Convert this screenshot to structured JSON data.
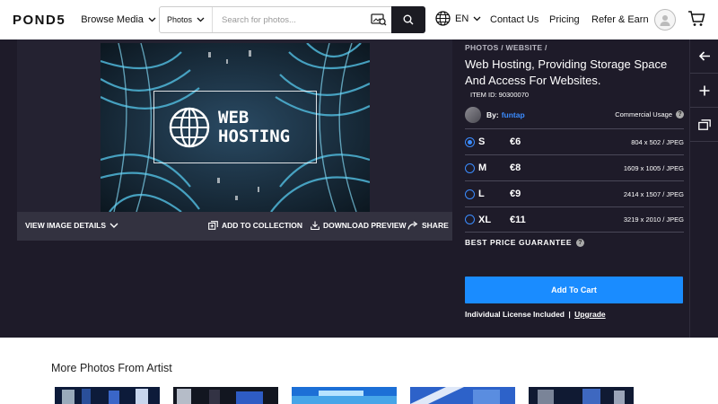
{
  "header": {
    "logo": "POND5",
    "browse_label": "Browse Media",
    "search_type": "Photos",
    "search_placeholder": "Search for photos...",
    "language": "EN",
    "nav": [
      "Contact Us",
      "Pricing",
      "Refer & Earn"
    ]
  },
  "image": {
    "overlay_line1": "WEB",
    "overlay_line2": "HOSTING",
    "details_label": "VIEW IMAGE DETAILS",
    "add_collection_label": "ADD TO COLLECTION",
    "download_preview_label": "DOWNLOAD PREVIEW",
    "share_label": "SHARE"
  },
  "panel": {
    "crumb1": "PHOTOS",
    "crumb2": "WEBSITE",
    "title": "Web Hosting, Providing Storage Space And Access For Websites.",
    "item_id": "ITEM ID: 90300070",
    "author_prefix": "By:",
    "author_name": "funtap",
    "commercial_label": "Commercial Usage",
    "sizes": [
      {
        "label": "S",
        "price": "€6",
        "dims": "804 x 502 / JPEG",
        "selected": true
      },
      {
        "label": "M",
        "price": "€8",
        "dims": "1609 x 1005 / JPEG",
        "selected": false
      },
      {
        "label": "L",
        "price": "€9",
        "dims": "2414 x 1507 / JPEG",
        "selected": false
      },
      {
        "label": "XL",
        "price": "€11",
        "dims": "3219 x 2010 / JPEG",
        "selected": false
      }
    ],
    "best_price": "BEST PRICE GUARANTEE",
    "add_to_cart": "Add To Cart",
    "license_text": "Individual License Included",
    "license_sep": "|",
    "upgrade": "Upgrade"
  },
  "more": {
    "title": "More Photos From Artist"
  },
  "colors": {
    "accent": "#1a8cff",
    "background": "#1e1b29",
    "link": "#3b8cff"
  }
}
